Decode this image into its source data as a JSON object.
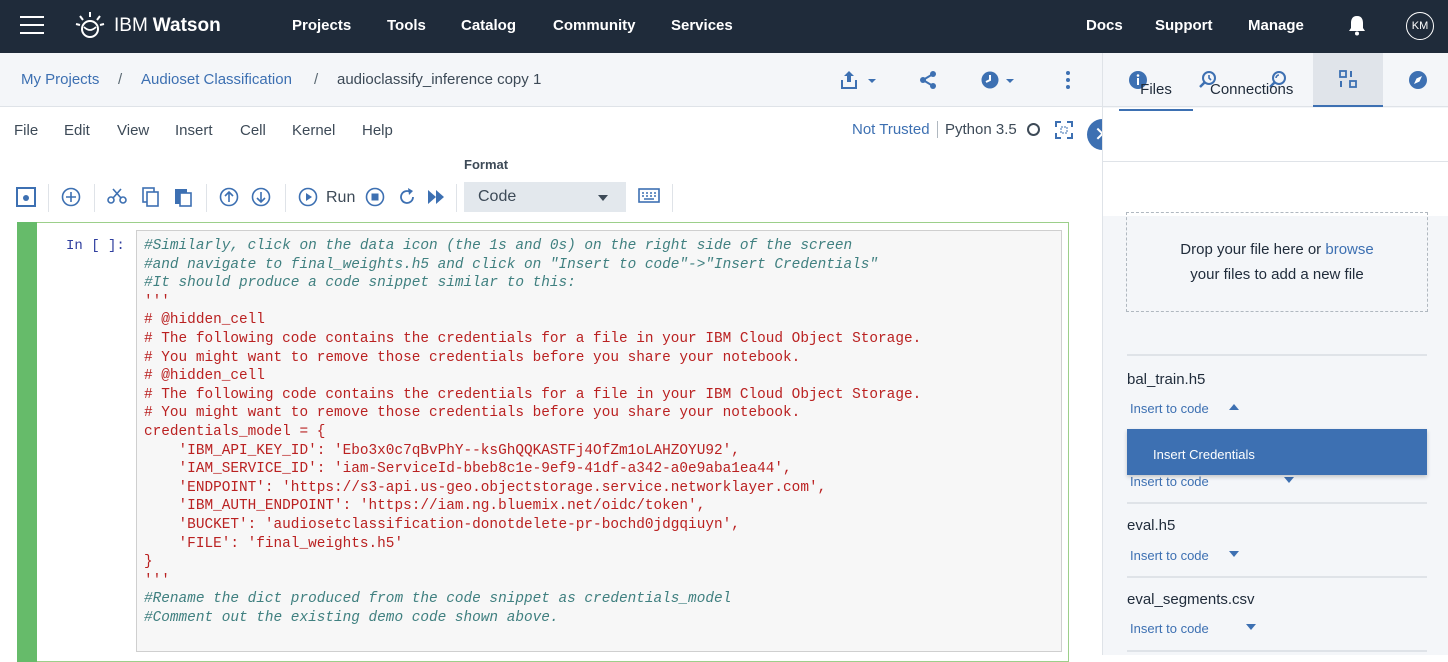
{
  "topbar": {
    "brand_prefix": "IBM",
    "brand_name": "Watson",
    "nav": [
      "Projects",
      "Tools",
      "Catalog",
      "Community",
      "Services"
    ],
    "right_nav": [
      "Docs",
      "Support",
      "Manage"
    ],
    "avatar_initials": "KM"
  },
  "breadcrumb": {
    "items": [
      "My Projects",
      "Audioset Classification",
      "audioclassify_inference copy 1"
    ],
    "separator": "/"
  },
  "menubar": {
    "items": [
      "File",
      "Edit",
      "View",
      "Insert",
      "Cell",
      "Kernel",
      "Help"
    ],
    "trust_status": "Not Trusted",
    "kernel_name": "Python 3.5"
  },
  "toolbar": {
    "format_label": "Format",
    "run_label": "Run",
    "cell_type": "Code"
  },
  "cell": {
    "prompt": "In [ ]:",
    "code_lines": [
      {
        "t": "cm",
        "text": "#Similarly, click on the data icon (the 1s and 0s) on the right side of the screen"
      },
      {
        "t": "cm",
        "text": "#and navigate to final_weights.h5 and click on \"Insert to code\"->\"Insert Credentials\""
      },
      {
        "t": "cm",
        "text": "#It should produce a code snippet similar to this:"
      },
      {
        "t": "str",
        "text": "'''"
      },
      {
        "t": "str",
        "text": "# @hidden_cell"
      },
      {
        "t": "str",
        "text": "# The following code contains the credentials for a file in your IBM Cloud Object Storage."
      },
      {
        "t": "str",
        "text": "# You might want to remove those credentials before you share your notebook."
      },
      {
        "t": "str",
        "text": "# @hidden_cell"
      },
      {
        "t": "str",
        "text": "# The following code contains the credentials for a file in your IBM Cloud Object Storage."
      },
      {
        "t": "str",
        "text": "# You might want to remove those credentials before you share your notebook."
      },
      {
        "t": "str",
        "text": "credentials_model = {"
      },
      {
        "t": "str",
        "text": "    'IBM_API_KEY_ID': 'Ebo3x0c7qBvPhY--ksGhQQKASTFj4OfZm1oLAHZOYU92',"
      },
      {
        "t": "str",
        "text": "    'IAM_SERVICE_ID': 'iam-ServiceId-bbeb8c1e-9ef9-41df-a342-a0e9aba1ea44',"
      },
      {
        "t": "str",
        "text": "    'ENDPOINT': 'https://s3-api.us-geo.objectstorage.service.networklayer.com',"
      },
      {
        "t": "str",
        "text": "    'IBM_AUTH_ENDPOINT': 'https://iam.ng.bluemix.net/oidc/token',"
      },
      {
        "t": "str",
        "text": "    'BUCKET': 'audiosetclassification-donotdelete-pr-bochd0jdgqiuyn',"
      },
      {
        "t": "str",
        "text": "    'FILE': 'final_weights.h5'"
      },
      {
        "t": "str",
        "text": "}"
      },
      {
        "t": "str",
        "text": "'''"
      },
      {
        "t": "cm",
        "text": "#Rename the dict produced from the code snippet as credentials_model"
      },
      {
        "t": "cm",
        "text": "#Comment out the existing demo code shown above."
      }
    ]
  },
  "panel": {
    "tabs": [
      "Files",
      "Connections"
    ],
    "drop_text_1": "Drop your file here or",
    "drop_link": "browse",
    "drop_text_2": "your files to add a new file",
    "insert_label": "Insert to code",
    "popup_item": "Insert Credentials",
    "files": [
      "bal_train.h5",
      "eval.h5",
      "eval_segments.csv"
    ]
  },
  "colors": {
    "topbar": "#1f2b3a",
    "accent": "#3d70b2",
    "cell_border": "#66bb6a",
    "comment": "#408080",
    "string": "#ba2121"
  }
}
